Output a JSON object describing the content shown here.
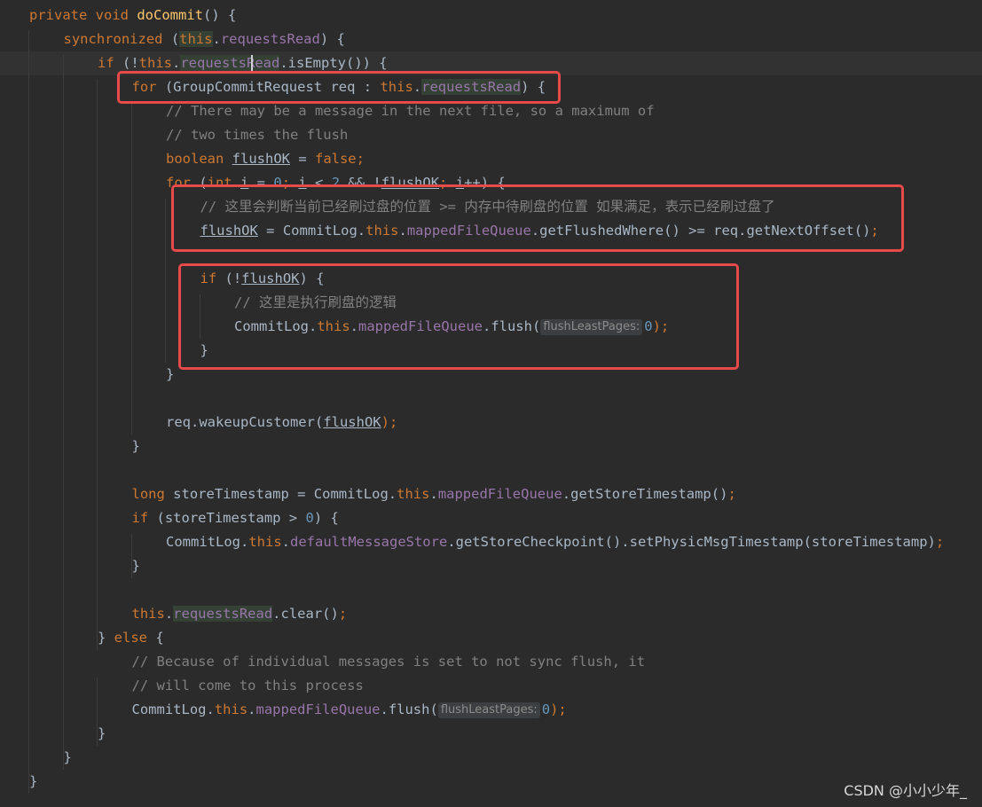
{
  "code_lines": [
    {
      "indent": 0,
      "segments": [
        {
          "t": "private void ",
          "c": "kw"
        },
        {
          "t": "doCommit",
          "c": "fn"
        },
        {
          "t": "() {",
          "c": ""
        }
      ]
    },
    {
      "indent": 1,
      "segments": [
        {
          "t": "synchronized ",
          "c": "kw"
        },
        {
          "t": "(",
          "c": ""
        },
        {
          "t": "this",
          "c": "kw hl"
        },
        {
          "t": ".",
          "c": ""
        },
        {
          "t": "requestsRead",
          "c": "fld"
        },
        {
          "t": ") {",
          "c": ""
        }
      ]
    },
    {
      "indent": 2,
      "current": true,
      "segments": [
        {
          "t": "if ",
          "c": "kw"
        },
        {
          "t": "(!",
          "c": ""
        },
        {
          "t": "this",
          "c": "kw"
        },
        {
          "t": ".",
          "c": ""
        },
        {
          "t": "requestsRead",
          "c": "fld hl"
        },
        {
          "t": ".isEmpty()) {",
          "c": ""
        }
      ]
    },
    {
      "indent": 3,
      "segments": [
        {
          "t": "for ",
          "c": "kw"
        },
        {
          "t": "(GroupCommitRequest req : ",
          "c": ""
        },
        {
          "t": "this",
          "c": "kw"
        },
        {
          "t": ".",
          "c": ""
        },
        {
          "t": "requestsRead",
          "c": "fld hl"
        },
        {
          "t": ") {",
          "c": ""
        }
      ]
    },
    {
      "indent": 4,
      "segments": [
        {
          "t": "// There may be a message in the next file, so a maximum of",
          "c": "cmt"
        }
      ]
    },
    {
      "indent": 4,
      "segments": [
        {
          "t": "// two times the flush",
          "c": "cmt"
        }
      ]
    },
    {
      "indent": 4,
      "segments": [
        {
          "t": "boolean ",
          "c": "kw"
        },
        {
          "t": "flushOK",
          "c": "ul"
        },
        {
          "t": " = ",
          "c": ""
        },
        {
          "t": "false",
          "c": "kw"
        },
        {
          "t": ";",
          "c": "kw"
        }
      ]
    },
    {
      "indent": 4,
      "segments": [
        {
          "t": "for ",
          "c": "kw"
        },
        {
          "t": "(",
          "c": ""
        },
        {
          "t": "int ",
          "c": "kw"
        },
        {
          "t": "i",
          "c": "ul"
        },
        {
          "t": " = ",
          "c": ""
        },
        {
          "t": "0",
          "c": "num"
        },
        {
          "t": "; ",
          "c": "kw"
        },
        {
          "t": "i",
          "c": "ul"
        },
        {
          "t": " < ",
          "c": ""
        },
        {
          "t": "2",
          "c": "num"
        },
        {
          "t": " && !",
          "c": ""
        },
        {
          "t": "flushOK",
          "c": "ul"
        },
        {
          "t": "; ",
          "c": "kw"
        },
        {
          "t": "i",
          "c": "ul"
        },
        {
          "t": "++) {",
          "c": ""
        }
      ]
    },
    {
      "indent": 5,
      "segments": [
        {
          "t": "// 这里会判断当前已经刷过盘的位置 >= 内存中待刷盘的位置 如果满足，表示已经刷过盘了",
          "c": "cmt"
        }
      ]
    },
    {
      "indent": 5,
      "segments": [
        {
          "t": "flushOK",
          "c": "ul"
        },
        {
          "t": " = CommitLog.",
          "c": ""
        },
        {
          "t": "this",
          "c": "kw"
        },
        {
          "t": ".",
          "c": ""
        },
        {
          "t": "mappedFileQueue",
          "c": "fld"
        },
        {
          "t": ".getFlushedWhere() >= req.getNextOffset()",
          "c": ""
        },
        {
          "t": ";",
          "c": "kw"
        }
      ]
    },
    {
      "indent": 5,
      "segments": []
    },
    {
      "indent": 5,
      "segments": [
        {
          "t": "if ",
          "c": "kw"
        },
        {
          "t": "(!",
          "c": ""
        },
        {
          "t": "flushOK",
          "c": "ul"
        },
        {
          "t": ") {",
          "c": ""
        }
      ]
    },
    {
      "indent": 6,
      "segments": [
        {
          "t": "// 这里是执行刷盘的逻辑",
          "c": "cmt"
        }
      ]
    },
    {
      "indent": 6,
      "segments": [
        {
          "t": "CommitLog.",
          "c": ""
        },
        {
          "t": "this",
          "c": "kw"
        },
        {
          "t": ".",
          "c": ""
        },
        {
          "t": "mappedFileQueue",
          "c": "fld"
        },
        {
          "t": ".flush(",
          "c": ""
        },
        {
          "t": "flushLeastPages:",
          "c": "hint"
        },
        {
          "t": "0",
          "c": "num"
        },
        {
          "t": ");",
          "c": "kw"
        }
      ]
    },
    {
      "indent": 5,
      "segments": [
        {
          "t": "}",
          "c": ""
        }
      ]
    },
    {
      "indent": 4,
      "segments": [
        {
          "t": "}",
          "c": ""
        }
      ]
    },
    {
      "indent": 4,
      "segments": []
    },
    {
      "indent": 4,
      "segments": [
        {
          "t": "req.wakeupCustomer(",
          "c": ""
        },
        {
          "t": "flushOK",
          "c": "ul"
        },
        {
          "t": ");",
          "c": "kw"
        }
      ]
    },
    {
      "indent": 3,
      "segments": [
        {
          "t": "}",
          "c": ""
        }
      ]
    },
    {
      "indent": 3,
      "segments": []
    },
    {
      "indent": 3,
      "segments": [
        {
          "t": "long ",
          "c": "kw"
        },
        {
          "t": "storeTimestamp = CommitLog.",
          "c": ""
        },
        {
          "t": "this",
          "c": "kw"
        },
        {
          "t": ".",
          "c": ""
        },
        {
          "t": "mappedFileQueue",
          "c": "fld"
        },
        {
          "t": ".getStoreTimestamp()",
          "c": ""
        },
        {
          "t": ";",
          "c": "kw"
        }
      ]
    },
    {
      "indent": 3,
      "segments": [
        {
          "t": "if ",
          "c": "kw"
        },
        {
          "t": "(storeTimestamp > ",
          "c": ""
        },
        {
          "t": "0",
          "c": "num"
        },
        {
          "t": ") {",
          "c": ""
        }
      ]
    },
    {
      "indent": 4,
      "segments": [
        {
          "t": "CommitLog.",
          "c": ""
        },
        {
          "t": "this",
          "c": "kw"
        },
        {
          "t": ".",
          "c": ""
        },
        {
          "t": "defaultMessageStore",
          "c": "fld"
        },
        {
          "t": ".getStoreCheckpoint().setPhysicMsgTimestamp(storeTimestamp)",
          "c": ""
        },
        {
          "t": ";",
          "c": "kw"
        }
      ]
    },
    {
      "indent": 3,
      "segments": [
        {
          "t": "}",
          "c": ""
        }
      ]
    },
    {
      "indent": 3,
      "segments": []
    },
    {
      "indent": 3,
      "segments": [
        {
          "t": "this",
          "c": "kw"
        },
        {
          "t": ".",
          "c": ""
        },
        {
          "t": "requestsRead",
          "c": "fld hl"
        },
        {
          "t": ".clear()",
          "c": ""
        },
        {
          "t": ";",
          "c": "kw"
        }
      ]
    },
    {
      "indent": 2,
      "segments": [
        {
          "t": "} ",
          "c": ""
        },
        {
          "t": "else ",
          "c": "kw"
        },
        {
          "t": "{",
          "c": ""
        }
      ]
    },
    {
      "indent": 3,
      "segments": [
        {
          "t": "// Because of individual messages is set to not sync flush, it",
          "c": "cmt"
        }
      ]
    },
    {
      "indent": 3,
      "segments": [
        {
          "t": "// will come to this process",
          "c": "cmt"
        }
      ]
    },
    {
      "indent": 3,
      "segments": [
        {
          "t": "CommitLog.",
          "c": ""
        },
        {
          "t": "this",
          "c": "kw"
        },
        {
          "t": ".",
          "c": ""
        },
        {
          "t": "mappedFileQueue",
          "c": "fld"
        },
        {
          "t": ".flush(",
          "c": ""
        },
        {
          "t": "flushLeastPages:",
          "c": "hint"
        },
        {
          "t": "0",
          "c": "num"
        },
        {
          "t": ");",
          "c": "kw"
        }
      ]
    },
    {
      "indent": 2,
      "segments": [
        {
          "t": "}",
          "c": ""
        }
      ]
    },
    {
      "indent": 1,
      "segments": [
        {
          "t": "}",
          "c": ""
        }
      ]
    },
    {
      "indent": 0,
      "segments": [
        {
          "t": "}",
          "c": ""
        }
      ]
    }
  ],
  "watermark": "CSDN @小小少年_",
  "colors": {
    "background": "#2b2b2b",
    "keyword": "#cc7832",
    "method": "#ffc66d",
    "field": "#9876aa",
    "number": "#6897bb",
    "comment": "#808080",
    "default": "#a9b7c6",
    "annotation_box": "#e84a4a"
  }
}
